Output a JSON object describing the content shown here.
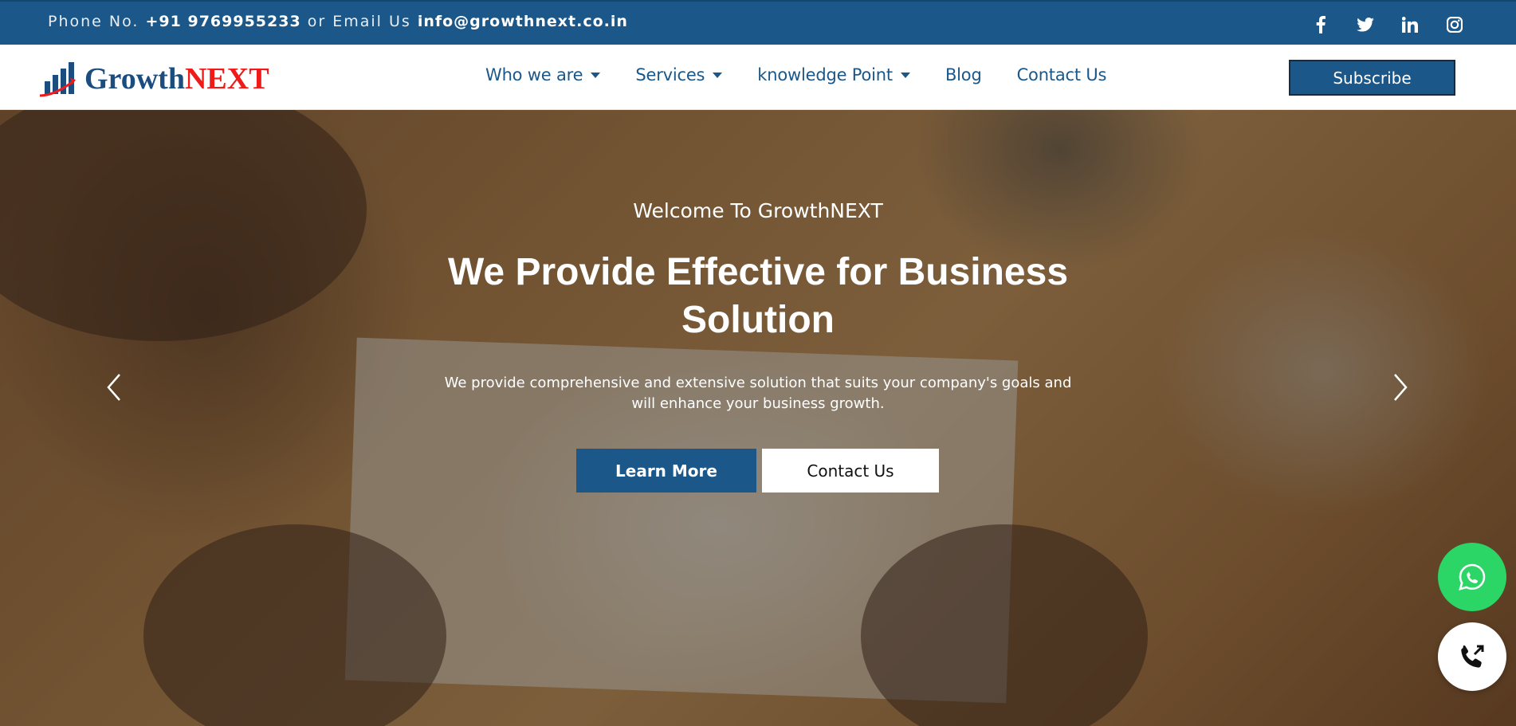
{
  "topbar": {
    "phone_prefix": "Phone No.",
    "phone": "+91 9769955233",
    "email_prefix": "or Email Us",
    "email": "info@growthnext.co.in",
    "social": [
      "facebook-icon",
      "twitter-icon",
      "linkedin-icon",
      "instagram-icon"
    ]
  },
  "header": {
    "logo_part1": "Growth",
    "logo_part2": "NEXT",
    "nav": [
      {
        "label": "Who we are",
        "dropdown": true
      },
      {
        "label": "Services",
        "dropdown": true
      },
      {
        "label": "knowledge Point",
        "dropdown": true
      },
      {
        "label": "Blog",
        "dropdown": false
      },
      {
        "label": "Contact Us",
        "dropdown": false
      }
    ],
    "subscribe_label": "Subscribe"
  },
  "hero": {
    "welcome": "Welcome To GrowthNEXT",
    "headline": "We Provide Effective for Business Solution",
    "subtext": "We provide comprehensive and extensive solution that suits your company's goals and will enhance your business growth.",
    "learn_more_label": "Learn More",
    "contact_label": "Contact Us"
  },
  "floating": {
    "whatsapp_icon": "whatsapp-icon",
    "call_icon": "phone-call-icon"
  },
  "colors": {
    "brand_blue": "#1b5788",
    "logo_red": "#ef1b1b",
    "whatsapp_green": "#2bd566"
  }
}
